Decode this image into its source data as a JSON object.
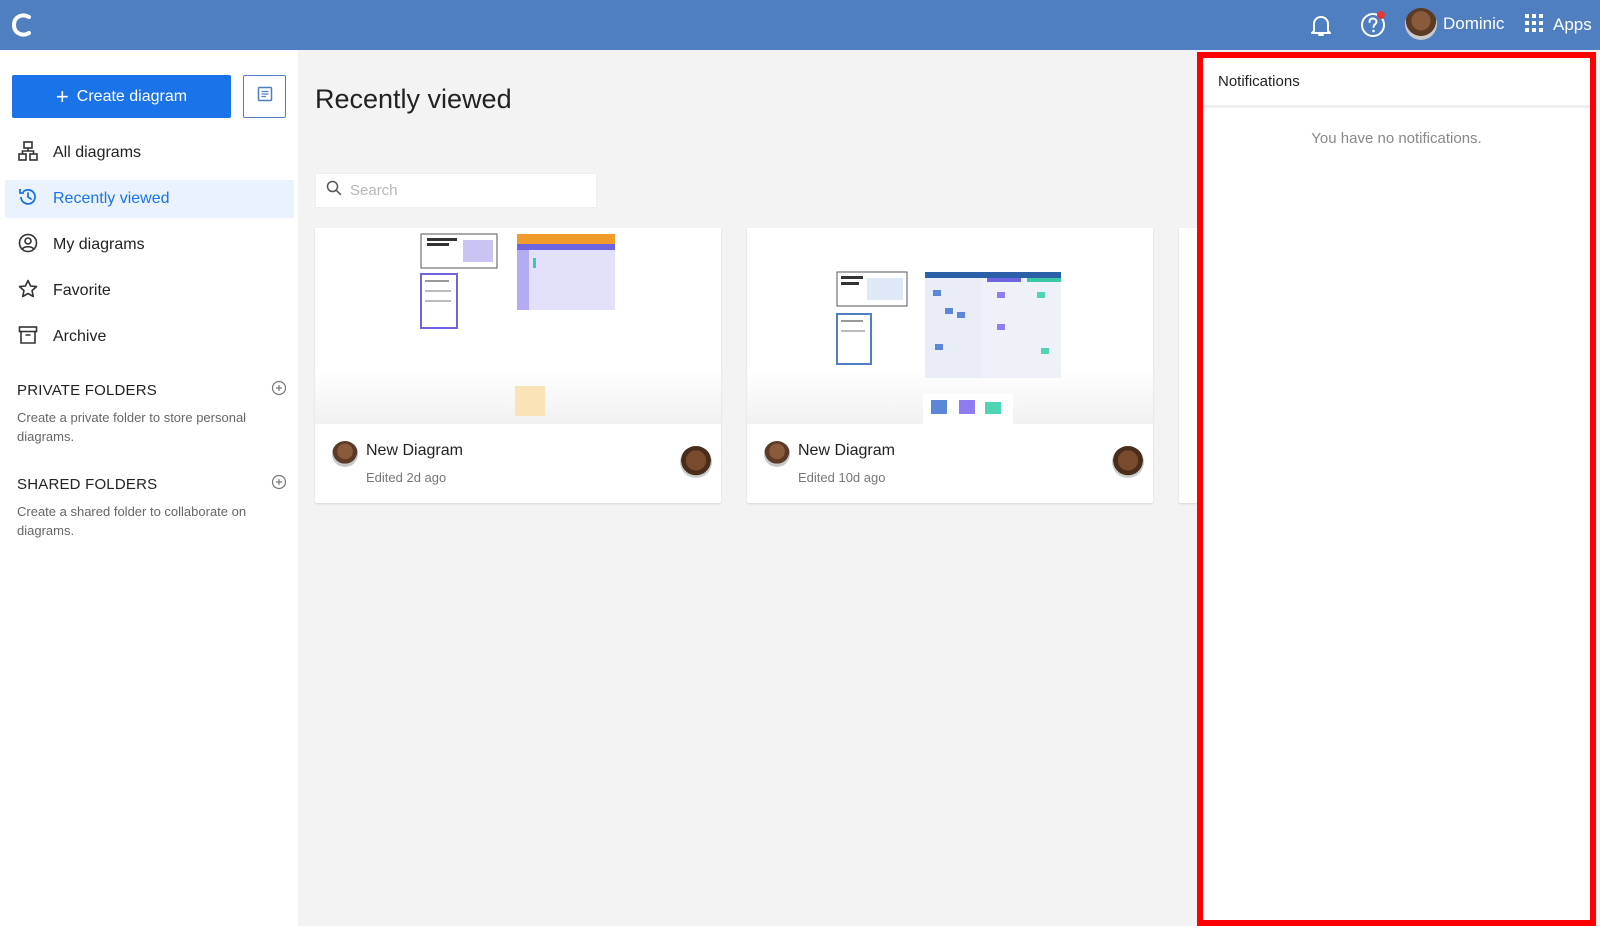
{
  "topbar": {
    "user_name": "Dominic",
    "apps_label": "Apps",
    "icons": [
      "logo-icon",
      "bell-icon",
      "help-icon",
      "apps-grid-icon"
    ]
  },
  "sidebar": {
    "create_label": "Create diagram",
    "nav": [
      {
        "label": "All diagrams",
        "icon": "diagram-icon"
      },
      {
        "label": "Recently viewed",
        "icon": "history-icon",
        "active": true
      },
      {
        "label": "My diagrams",
        "icon": "user-circle-icon"
      },
      {
        "label": "Favorite",
        "icon": "star-icon"
      },
      {
        "label": "Archive",
        "icon": "archive-icon"
      }
    ],
    "private_folders": {
      "title": "PRIVATE FOLDERS",
      "description": "Create a private folder to store personal diagrams."
    },
    "shared_folders": {
      "title": "SHARED FOLDERS",
      "description": "Create a shared folder to collaborate on diagrams."
    }
  },
  "main": {
    "title": "Recently viewed",
    "search_placeholder": "Search",
    "cards": [
      {
        "name": "New Diagram",
        "edited": "Edited 2d ago"
      },
      {
        "name": "New Diagram",
        "edited": "Edited 10d ago"
      }
    ]
  },
  "notifications": {
    "title": "Notifications",
    "empty_message": "You have no notifications."
  },
  "colors": {
    "topbar": "#4f7fc1",
    "primary": "#1a73e8",
    "highlight_border": "#ff0000"
  }
}
